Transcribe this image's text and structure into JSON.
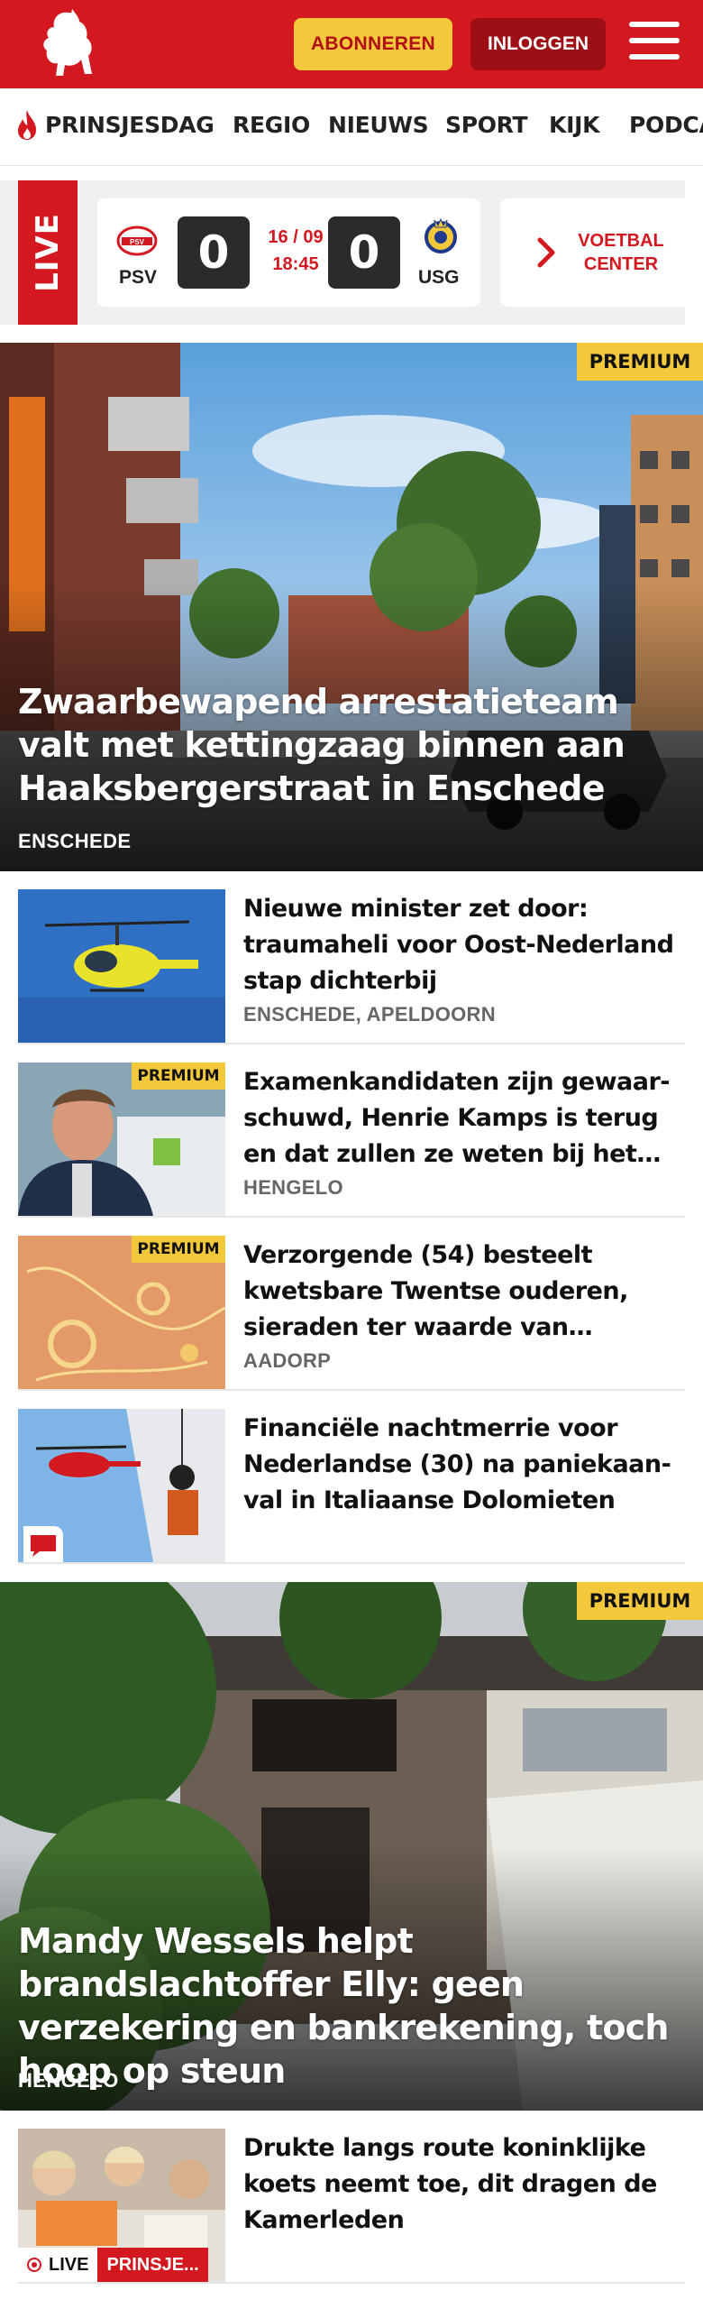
{
  "header": {
    "subscribe_label": "ABONNEREN",
    "login_label": "INLOGGEN"
  },
  "nav": {
    "items": [
      "PRINSJESDAG",
      "REGIO",
      "NIEUWS",
      "SPORT",
      "KIJK",
      "PODCA"
    ]
  },
  "live": {
    "label": "LIVE",
    "match": {
      "home": "PSV",
      "away": "USG",
      "home_score": "0",
      "away_score": "0",
      "date": "16 / 09",
      "time": "18:45"
    },
    "voetbal_center": "VOETBAL CENTER"
  },
  "premium_label": "PREMIUM",
  "hero1": {
    "title": "Zwaarbewapend arrestatieteam valt met kettingzaag binnen aan Haaksbergerstraat in Enschede",
    "location": "ENSCHEDE"
  },
  "articles": [
    {
      "title": "Nieuwe minister zet door: traumaheli voor Oost-Nederland stap dichterbij",
      "location": "ENSCHEDE, APELDOORN"
    },
    {
      "title": "Examenkandidaten zijn gewaar­schuwd, Henrie Kamps is terug en dat zullen ze weten bij het…",
      "location": "HENGELO"
    },
    {
      "title": "Verzorgende (54) besteelt kwetsbare Twentse ouderen, sieraden ter waarde van…",
      "location": "AADORP"
    },
    {
      "title": "Financiële nachtmerrie voor Nederlandse (30) na paniekaan­val in Italiaanse Dolomieten",
      "location": ""
    }
  ],
  "hero2": {
    "title": "Mandy Wessels helpt brandslachtof­fer Elly: geen verzekering en bankrekening, toch hoop op steun",
    "location": "HENGELO"
  },
  "articles2": [
    {
      "title": "Drukte langs route koninklijke koets neemt toe, dit dragen de Kamerleden",
      "live_label": "LIVE",
      "tag": "PRINSJE..."
    }
  ],
  "colors": {
    "brand_red": "#d3181f",
    "premium_yellow": "#f4c83b",
    "login_dark_red": "#9e0f15"
  }
}
